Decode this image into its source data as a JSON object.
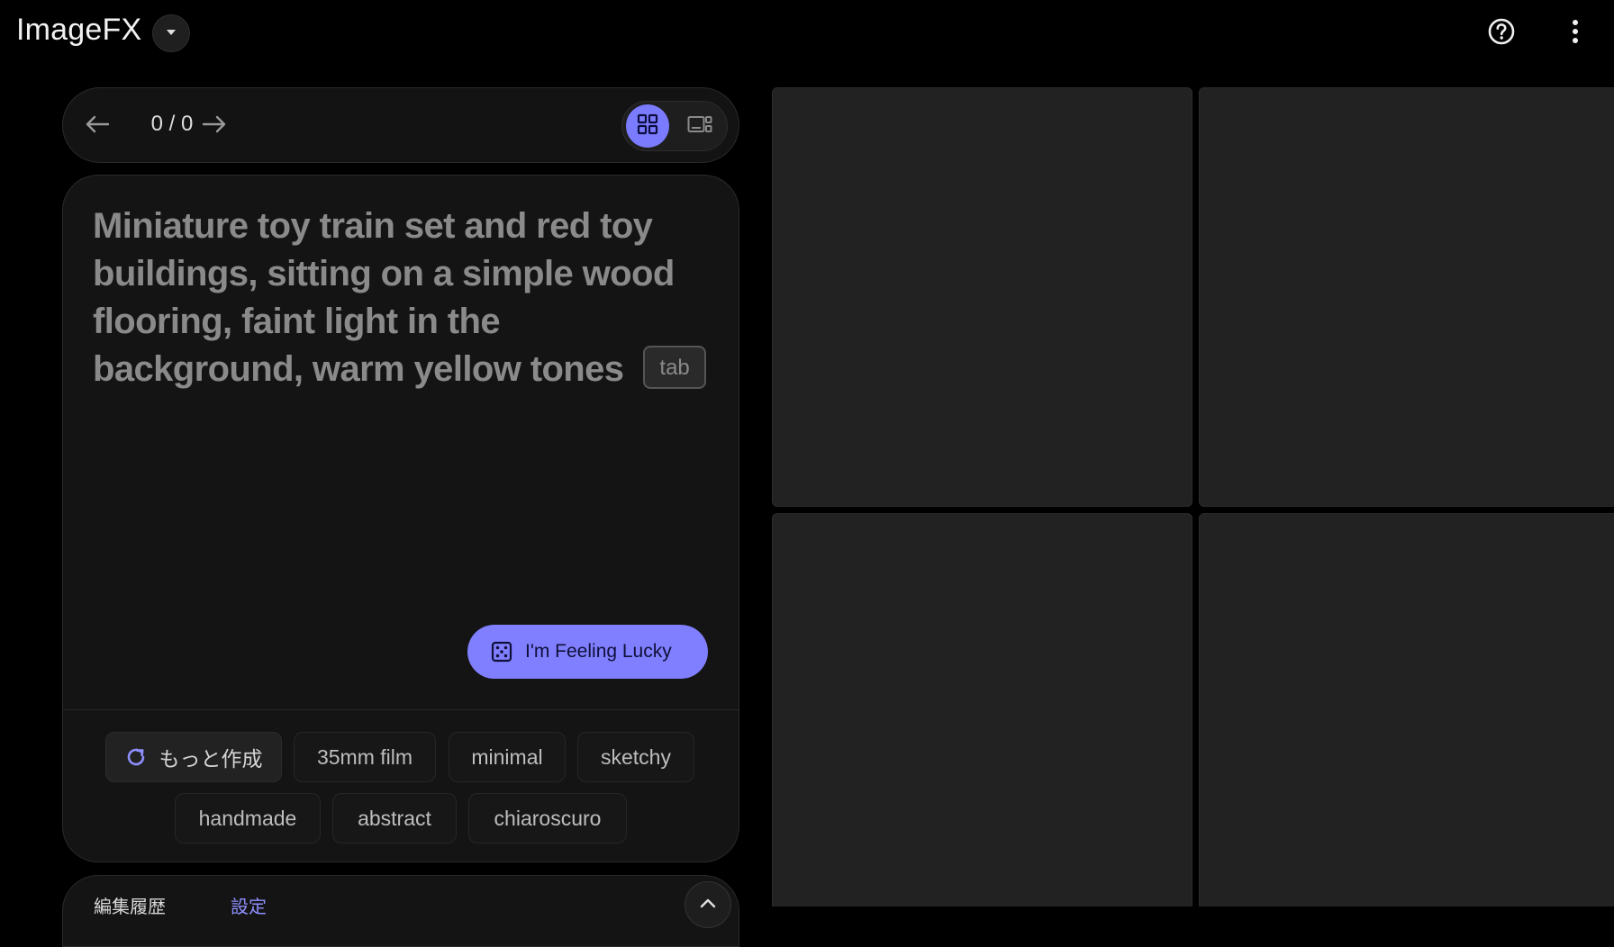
{
  "app": {
    "title": "ImageFX"
  },
  "pager": {
    "counter": "0 / 0"
  },
  "prompt": {
    "text": "Miniature toy train set and red toy buildings, sitting on a simple wood flooring, faint light in the background, warm yellow tones",
    "tab_hint": "tab"
  },
  "lucky_button": {
    "label": "I'm Feeling Lucky"
  },
  "chips": {
    "more_label": "もっと作成",
    "items": [
      "35mm film",
      "minimal",
      "sketchy",
      "handmade",
      "abstract",
      "chiaroscuro"
    ]
  },
  "bottom_tabs": {
    "history": "編集履歴",
    "settings": "設定"
  },
  "colors": {
    "accent": "#7b7bff",
    "background": "#000000",
    "panel": "#141414",
    "tile": "#222222",
    "settings_tab": "#8f8fff"
  },
  "icons": {
    "brand_dropdown": "caret-down-icon",
    "help": "help-circle-icon",
    "more": "more-vert-icon",
    "prev": "arrow-left-icon",
    "next": "arrow-right-icon",
    "grid_view": "grid-view-icon",
    "single_view": "single-view-icon",
    "lucky": "dice-icon",
    "refresh": "refresh-icon",
    "collapse": "chevron-up-icon"
  }
}
